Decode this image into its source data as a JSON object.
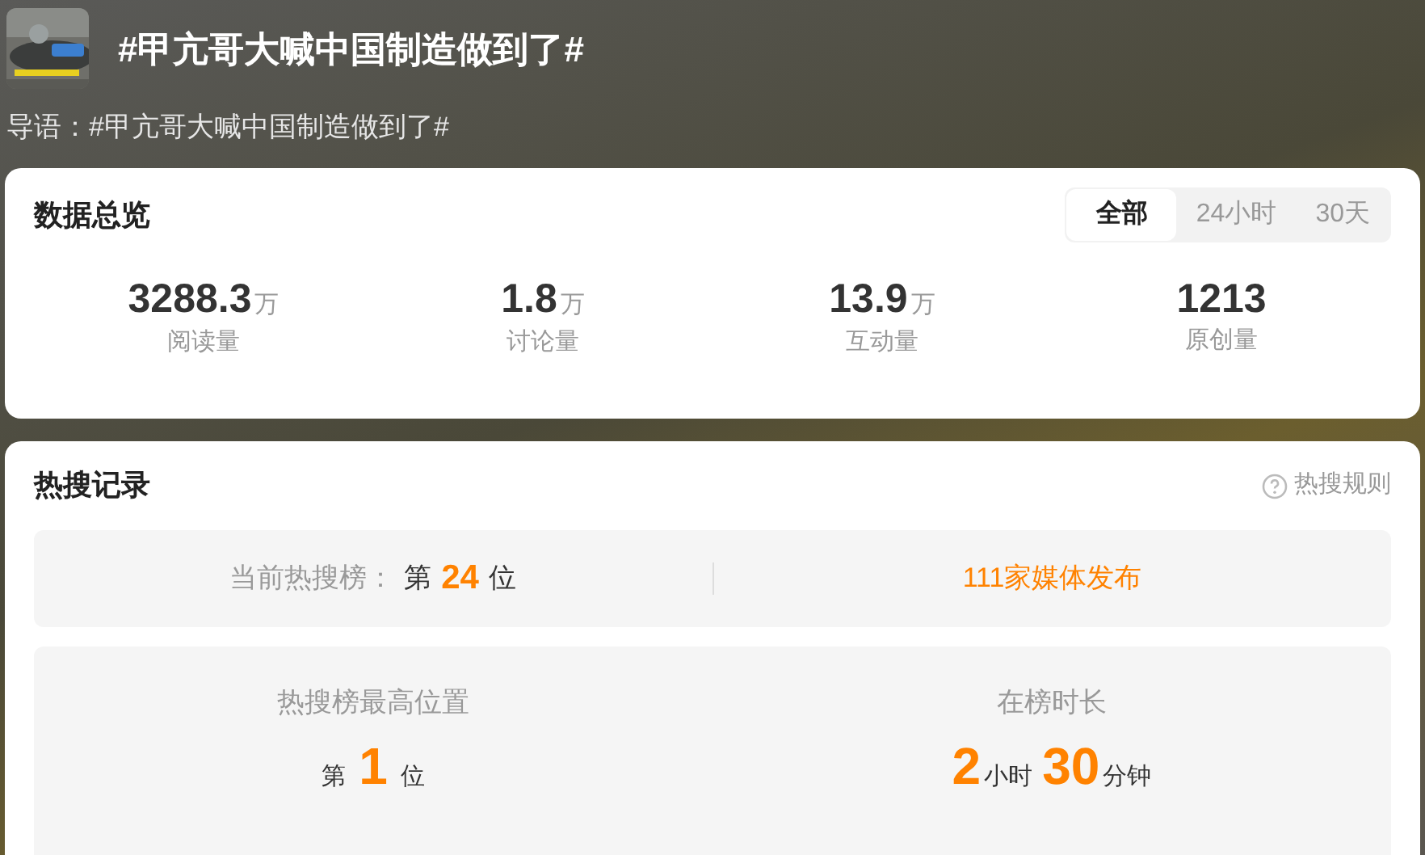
{
  "header": {
    "title": "#甲亢哥大喊中国制造做到了#",
    "intro": "导语：#甲亢哥大喊中国制造做到了#"
  },
  "overview": {
    "title": "数据总览",
    "tabs": [
      {
        "label": "全部",
        "selected": true
      },
      {
        "label": "24小时",
        "selected": false
      },
      {
        "label": "30天",
        "selected": false
      }
    ],
    "stats": [
      {
        "value": "3288.3",
        "unit": "万",
        "label": "阅读量"
      },
      {
        "value": "1.8",
        "unit": "万",
        "label": "讨论量"
      },
      {
        "value": "13.9",
        "unit": "万",
        "label": "互动量"
      },
      {
        "value": "1213",
        "label": "原创量"
      }
    ]
  },
  "hot_search": {
    "title": "热搜记录",
    "rules_link": "热搜规则",
    "current": {
      "label": "当前热搜榜：",
      "prefix": "第",
      "rank": "24",
      "suffix": "位"
    },
    "media": "111家媒体发布",
    "peak": {
      "label": "热搜榜最高位置",
      "prefix": "第",
      "rank": "1",
      "suffix": "位"
    },
    "duration": {
      "label": "在榜时长",
      "hours": "2",
      "hours_unit": "小时",
      "minutes": "30",
      "minutes_unit": "分钟"
    }
  }
}
